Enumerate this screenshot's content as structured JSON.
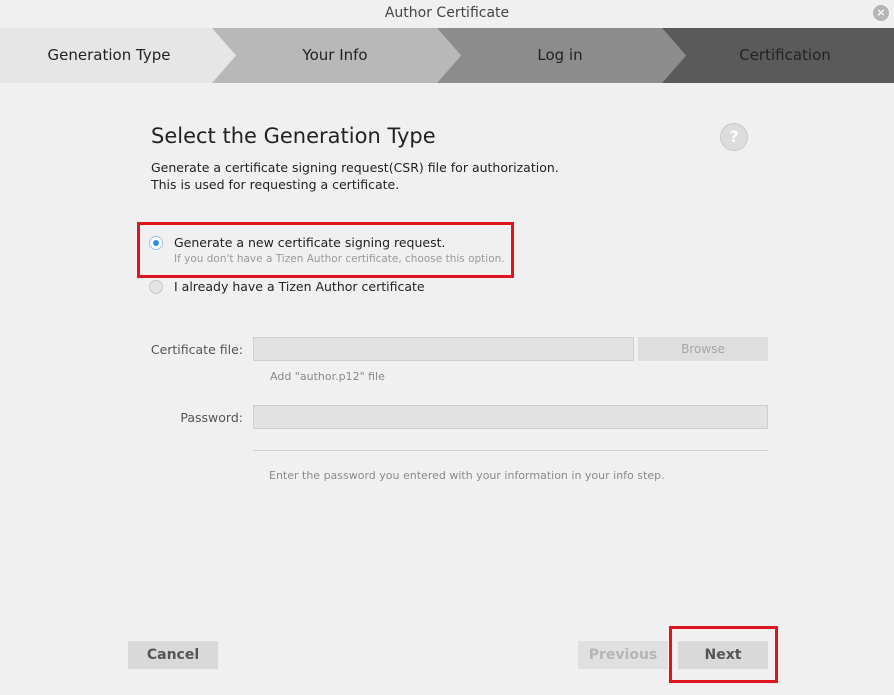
{
  "window": {
    "title": "Author Certificate",
    "close_glyph": "×"
  },
  "steps": [
    {
      "label": "Generation Type",
      "fill": "#e6e6e6",
      "text_color": "#222222"
    },
    {
      "label": "Your Info",
      "fill": "#b8b8b8",
      "text_color": "#222222"
    },
    {
      "label": "Log in",
      "fill": "#8c8c8c",
      "text_color": "#222222"
    },
    {
      "label": "Certification",
      "fill": "#5a5a5a",
      "text_color": "#222222"
    }
  ],
  "main": {
    "heading": "Select the Generation Type",
    "help_glyph": "?",
    "description": [
      "Generate a certificate signing request(CSR) file for authorization.",
      "This is used for requesting a certificate."
    ]
  },
  "options": [
    {
      "label": "Generate a new certificate signing request.",
      "hint": "If you don't have a Tizen Author certificate, choose this option.",
      "selected": true
    },
    {
      "label": "I already have a Tizen Author certificate",
      "selected": false
    }
  ],
  "form": {
    "cert_label": "Certificate file:",
    "cert_value": "",
    "browse_label": "Browse",
    "cert_hint": "Add \"author.p12\" file",
    "password_label": "Password:",
    "password_value": "",
    "password_hint": "Enter the password you entered with your information in your info step."
  },
  "buttons": {
    "cancel": "Cancel",
    "previous": "Previous",
    "next": "Next"
  },
  "colors": {
    "highlight": "#e0141e",
    "radio_selected": "#2f8cea"
  }
}
